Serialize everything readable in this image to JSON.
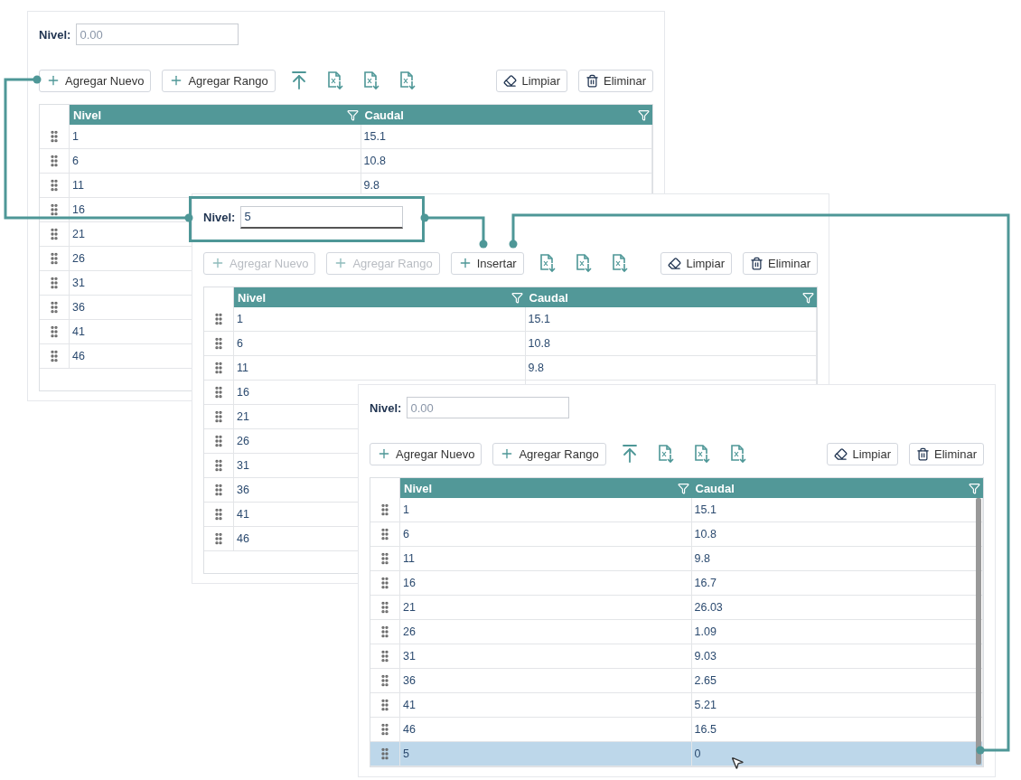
{
  "panels": [
    {
      "field": {
        "label": "Nivel:",
        "placeholder": "0.00",
        "focused": false
      },
      "toolbar_left": [
        {
          "kind": "add",
          "label": "Agregar Nuevo",
          "disabled": false
        },
        {
          "kind": "add",
          "label": "Agregar Rango",
          "disabled": false
        },
        {
          "kind": "upload"
        },
        {
          "kind": "pdf"
        },
        {
          "kind": "excel"
        },
        {
          "kind": "word"
        }
      ],
      "toolbar_right": [
        {
          "kind": "clear",
          "label": "Limpiar"
        },
        {
          "kind": "delete",
          "label": "Eliminar"
        }
      ],
      "columns": [
        "Nivel",
        "Caudal"
      ],
      "rows": [
        {
          "nivel": "1",
          "caudal": "15.1",
          "selected": false
        },
        {
          "nivel": "6",
          "caudal": "10.8",
          "selected": false
        },
        {
          "nivel": "11",
          "caudal": "9.8",
          "selected": false
        },
        {
          "nivel": "16",
          "selected": false
        },
        {
          "nivel": "21",
          "selected": false
        },
        {
          "nivel": "26",
          "selected": false
        },
        {
          "nivel": "31",
          "selected": false
        },
        {
          "nivel": "36",
          "selected": false
        },
        {
          "nivel": "41",
          "selected": false
        },
        {
          "nivel": "46",
          "selected": false
        }
      ]
    },
    {
      "field": {
        "label": "Nivel:",
        "value": "5",
        "focused": true
      },
      "toolbar_left": [
        {
          "kind": "add",
          "label": "Agregar Nuevo",
          "disabled": true
        },
        {
          "kind": "add",
          "label": "Agregar Rango",
          "disabled": true
        },
        {
          "kind": "add",
          "label": "Insertar",
          "disabled": false
        },
        {
          "kind": "pdf"
        },
        {
          "kind": "excel"
        },
        {
          "kind": "word"
        }
      ],
      "toolbar_right": [
        {
          "kind": "clear",
          "label": "Limpiar"
        },
        {
          "kind": "delete",
          "label": "Eliminar"
        }
      ],
      "columns": [
        "Nivel",
        "Caudal"
      ],
      "rows": [
        {
          "nivel": "1",
          "caudal": "15.1",
          "selected": false
        },
        {
          "nivel": "6",
          "caudal": "10.8",
          "selected": false
        },
        {
          "nivel": "11",
          "caudal": "9.8",
          "selected": false
        },
        {
          "nivel": "16",
          "selected": false
        },
        {
          "nivel": "21",
          "selected": false
        },
        {
          "nivel": "26",
          "selected": false
        },
        {
          "nivel": "31",
          "selected": false
        },
        {
          "nivel": "36",
          "selected": false
        },
        {
          "nivel": "41",
          "selected": false
        },
        {
          "nivel": "46",
          "selected": false
        }
      ]
    },
    {
      "field": {
        "label": "Nivel:",
        "placeholder": "0.00",
        "focused": false
      },
      "toolbar_left": [
        {
          "kind": "add",
          "label": "Agregar Nuevo",
          "disabled": false
        },
        {
          "kind": "add",
          "label": "Agregar Rango",
          "disabled": false
        },
        {
          "kind": "upload"
        },
        {
          "kind": "pdf"
        },
        {
          "kind": "excel"
        },
        {
          "kind": "word"
        }
      ],
      "toolbar_right": [
        {
          "kind": "clear",
          "label": "Limpiar"
        },
        {
          "kind": "delete",
          "label": "Eliminar"
        }
      ],
      "columns": [
        "Nivel",
        "Caudal"
      ],
      "rows": [
        {
          "nivel": "1",
          "caudal": "15.1",
          "selected": false
        },
        {
          "nivel": "6",
          "caudal": "10.8",
          "selected": false
        },
        {
          "nivel": "11",
          "caudal": "9.8",
          "selected": false
        },
        {
          "nivel": "16",
          "caudal": "16.7",
          "selected": false
        },
        {
          "nivel": "21",
          "caudal": "26.03",
          "selected": false
        },
        {
          "nivel": "26",
          "caudal": "1.09",
          "selected": false
        },
        {
          "nivel": "31",
          "caudal": "9.03",
          "selected": false
        },
        {
          "nivel": "36",
          "caudal": "2.65",
          "selected": false
        },
        {
          "nivel": "41",
          "caudal": "5.21",
          "selected": false
        },
        {
          "nivel": "46",
          "caudal": "16.5",
          "selected": false
        },
        {
          "nivel": "5",
          "caudal": "0",
          "selected": true
        }
      ]
    }
  ]
}
